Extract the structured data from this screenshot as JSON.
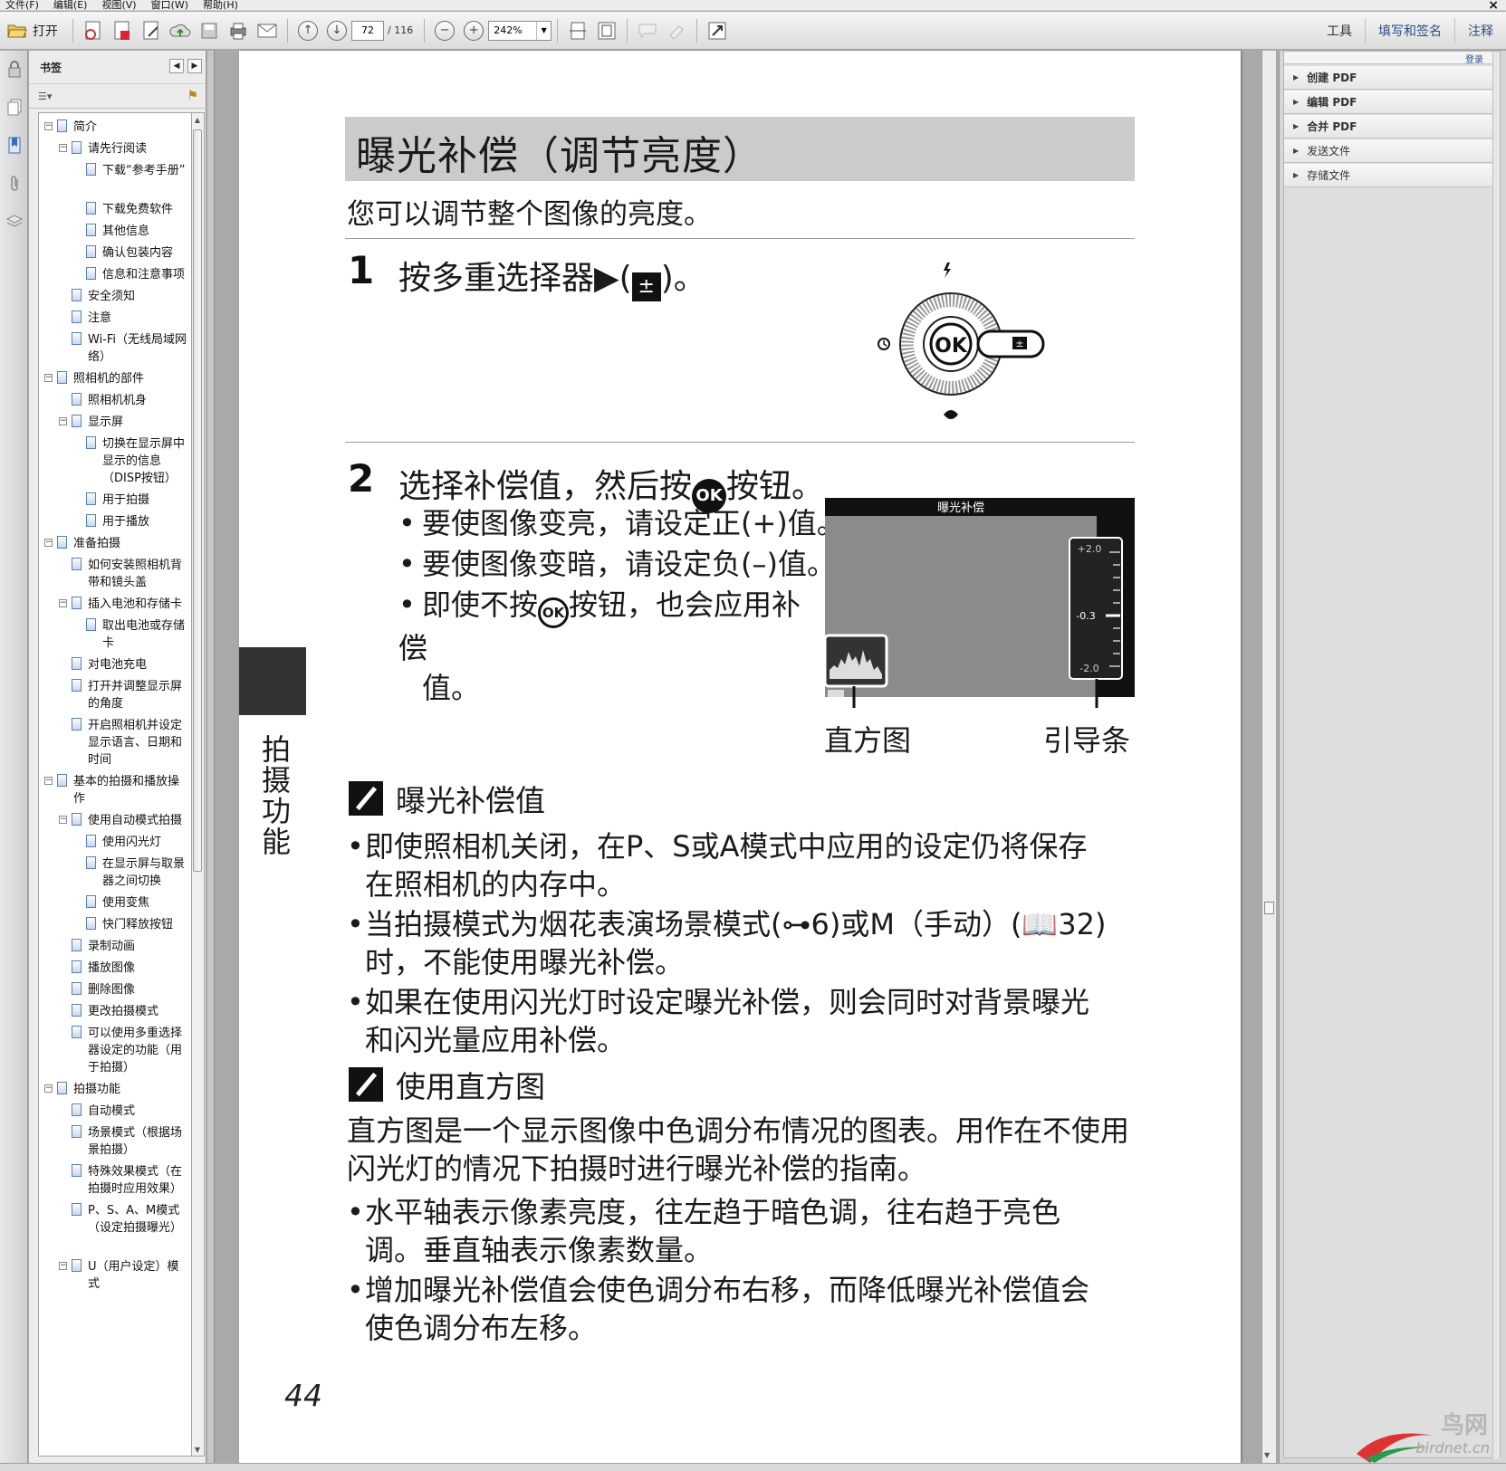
{
  "menu": {
    "file": "文件(F)",
    "edit": "编辑(E)",
    "view": "视图(V)",
    "window": "窗口(W)",
    "help": "帮助(H)",
    "close": "×"
  },
  "toolbar": {
    "open_label": "打开",
    "current_page": "72",
    "total_pages": "/ 116",
    "zoom": "242%",
    "tools": "工具",
    "fill_sign": "填写和签名",
    "comment": "注释"
  },
  "bookmarks": {
    "title": "书签",
    "items": [
      {
        "level": 0,
        "toggle": "⊟",
        "label": "简介"
      },
      {
        "level": 1,
        "toggle": "⊟",
        "label": "请先行阅读"
      },
      {
        "level": 2,
        "toggle": "",
        "label": "下载“参考手册”"
      },
      {
        "level": 2,
        "toggle": "",
        "label": "下载免费软件"
      },
      {
        "level": 2,
        "toggle": "",
        "label": "其他信息"
      },
      {
        "level": 2,
        "toggle": "",
        "label": "确认包装内容"
      },
      {
        "level": 2,
        "toggle": "",
        "label": "信息和注意事项"
      },
      {
        "level": 1,
        "toggle": "",
        "label": "安全须知"
      },
      {
        "level": 1,
        "toggle": "",
        "label": "注意"
      },
      {
        "level": 1,
        "toggle": "",
        "label": "Wi-Fi（无线局域网络）"
      },
      {
        "level": 0,
        "toggle": "⊟",
        "label": "照相机的部件"
      },
      {
        "level": 1,
        "toggle": "",
        "label": "照相机机身"
      },
      {
        "level": 1,
        "toggle": "⊟",
        "label": "显示屏"
      },
      {
        "level": 2,
        "toggle": "",
        "label": "切换在显示屏中显示的信息（DISP按钮）"
      },
      {
        "level": 2,
        "toggle": "",
        "label": "用于拍摄"
      },
      {
        "level": 2,
        "toggle": "",
        "label": "用于播放"
      },
      {
        "level": 0,
        "toggle": "⊟",
        "label": "准备拍摄"
      },
      {
        "level": 1,
        "toggle": "",
        "label": "如何安装照相机背带和镜头盖"
      },
      {
        "level": 1,
        "toggle": "⊟",
        "label": "插入电池和存储卡"
      },
      {
        "level": 2,
        "toggle": "",
        "label": "取出电池或存储卡"
      },
      {
        "level": 1,
        "toggle": "",
        "label": "对电池充电"
      },
      {
        "level": 1,
        "toggle": "",
        "label": "打开并调整显示屏的角度"
      },
      {
        "level": 1,
        "toggle": "",
        "label": "开启照相机并设定显示语言、日期和时间"
      },
      {
        "level": 0,
        "toggle": "⊟",
        "label": "基本的拍摄和播放操作"
      },
      {
        "level": 1,
        "toggle": "⊟",
        "label": "使用自动模式拍摄"
      },
      {
        "level": 2,
        "toggle": "",
        "label": "使用闪光灯"
      },
      {
        "level": 2,
        "toggle": "",
        "label": "在显示屏与取景器之间切换"
      },
      {
        "level": 2,
        "toggle": "",
        "label": "使用变焦"
      },
      {
        "level": 2,
        "toggle": "",
        "label": "快门释放按钮"
      },
      {
        "level": 1,
        "toggle": "",
        "label": "录制动画"
      },
      {
        "level": 1,
        "toggle": "",
        "label": "播放图像"
      },
      {
        "level": 1,
        "toggle": "",
        "label": "删除图像"
      },
      {
        "level": 1,
        "toggle": "",
        "label": "更改拍摄模式"
      },
      {
        "level": 1,
        "toggle": "",
        "label": "可以使用多重选择器设定的功能（用于拍摄）"
      },
      {
        "level": 0,
        "toggle": "⊟",
        "label": "拍摄功能"
      },
      {
        "level": 1,
        "toggle": "",
        "label": "自动模式"
      },
      {
        "level": 1,
        "toggle": "",
        "label": "场景模式（根据场景拍摄）"
      },
      {
        "level": 1,
        "toggle": "",
        "label": "特殊效果模式（在拍摄时应用效果）"
      },
      {
        "level": 1,
        "toggle": "",
        "label": "P、S、A、M模式（设定拍摄曝光）"
      },
      {
        "level": 1,
        "toggle": "⊟",
        "label": "U（用户设定）模式"
      }
    ]
  },
  "doc": {
    "title": "曝光补偿（调节亮度）",
    "intro": "您可以调节整个图像的亮度。",
    "step1_num": "1",
    "step1_text": "按多重选择器▶(",
    "step1_tail": ")。",
    "step2_num": "2",
    "step2_a": "选择补偿值，然后按",
    "step2_b": "按钮。",
    "b1": "要使图像变亮，请设定正(+)值。",
    "b2": "要使图像变暗，请设定负(–)值。",
    "b3_a": "即使不按",
    "b3_b": "按钮，也会应用补偿",
    "b3_c": "值。",
    "ok": "OK",
    "screen_title": "曝光补偿",
    "scale_top": "+2.0",
    "scale_mid": "-0.3",
    "scale_bot": "-2.0",
    "cap_histogram": "直方图",
    "cap_guide": "引导条",
    "note1_title": "曝光补偿值",
    "n1": "即使照相机关闭，在P、S或A模式中应用的设定仍将保存在照相机的内存中。",
    "n2": "当拍摄模式为烟花表演场景模式(⊶6)或M（手动）(📖32)时，不能使用曝光补偿。",
    "n3": "如果在使用闪光灯时设定曝光补偿，则会同时对背景曝光和闪光量应用补偿。",
    "note2_title": "使用直方图",
    "p1": "直方图是一个显示图像中色调分布情况的图表。用作在不使用闪光灯的情况下拍摄时进行曝光补偿的指南。",
    "h1": "水平轴表示像素亮度，往左趋于暗色调，往右趋于亮色调。垂直轴表示像素数量。",
    "h2": "增加曝光补偿值会使色调分布右移，而降低曝光补偿值会使色调分布左移。",
    "side_label": "拍摄功能",
    "page_number": "44"
  },
  "tools_panel": {
    "login": "登录",
    "create": "创建 PDF",
    "edit": "编辑 PDF",
    "merge": "合并 PDF",
    "send": "发送文件",
    "store": "存储文件"
  },
  "watermark": {
    "name": "鸟网",
    "url": "birdnet.cn"
  }
}
